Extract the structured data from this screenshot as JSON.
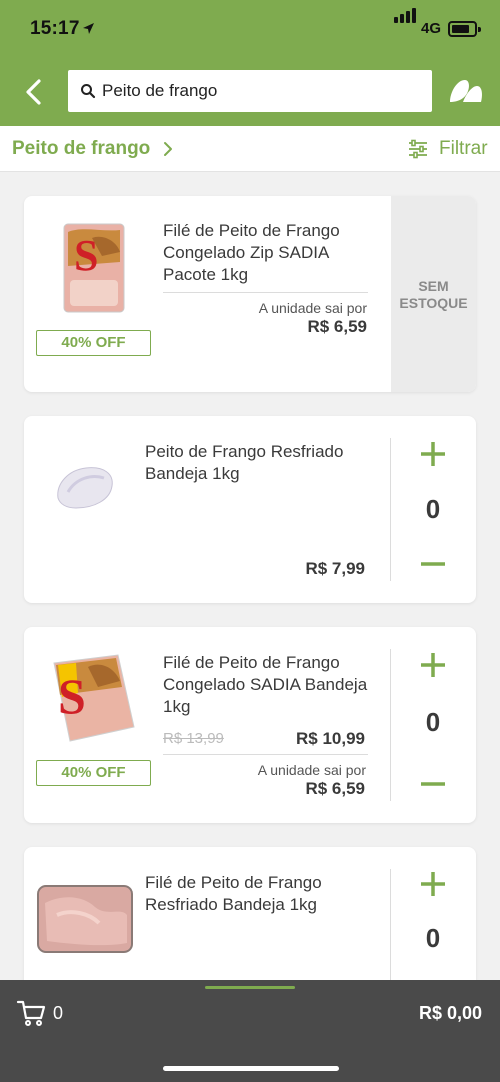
{
  "status_bar": {
    "time": "15:17",
    "network": "4G"
  },
  "search": {
    "value": "Peito de frango",
    "placeholder": ""
  },
  "breadcrumb": {
    "label": "Peito de frango"
  },
  "filter": {
    "label": "Filtrar"
  },
  "products": [
    {
      "name": "Filé de Peito de Frango Congelado Zip SADIA Pacote 1kg",
      "unit_label": "A unidade sai por",
      "unit_price": "R$ 6,59",
      "discount": "40% OFF",
      "stock_status": "SEM ESTOQUE"
    },
    {
      "name": "Peito de Frango Resfriado Bandeja 1kg",
      "price": "R$ 7,99",
      "quantity": "0"
    },
    {
      "name": "Filé de Peito de Frango Congelado SADIA Bandeja 1kg",
      "old_price": "R$ 13,99",
      "price": "R$ 10,99",
      "unit_label": "A unidade sai por",
      "unit_price": "R$ 6,59",
      "discount": "40% OFF",
      "quantity": "0"
    },
    {
      "name": "Filé de Peito de Frango Resfriado Bandeja 1kg",
      "quantity": "0"
    }
  ],
  "cart": {
    "count": "0",
    "total": "R$ 0,00"
  },
  "colors": {
    "brand": "#7fab4f",
    "cart_bar": "#4a4a4a",
    "background": "#f1f1f1"
  }
}
